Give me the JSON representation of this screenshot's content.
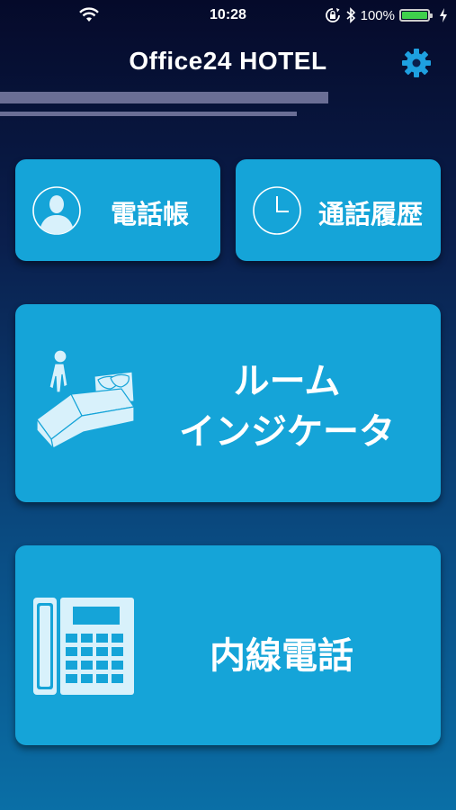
{
  "status_bar": {
    "time": "10:28",
    "battery_percent": "100%",
    "battery_level": 1.0,
    "icons": [
      "wifi-icon",
      "rotation-lock-icon",
      "bluetooth-icon",
      "battery-icon",
      "charging-icon"
    ]
  },
  "header": {
    "title": "Office24 HOTEL",
    "settings_icon": "gear-icon"
  },
  "menu": {
    "phonebook": {
      "label": "電話帳",
      "icon": "person-icon"
    },
    "call_history": {
      "label": "通話履歴",
      "icon": "clock-icon"
    },
    "room_indicator": {
      "label_line1": "ルーム",
      "label_line2": "インジケータ",
      "icon": "bed-icon"
    },
    "extension_phone": {
      "label": "内線電話",
      "icon": "desk-phone-icon"
    }
  },
  "colors": {
    "tile": "#15a4d8",
    "accent_gear": "#1ea0e0",
    "battery": "#3fd14c"
  }
}
